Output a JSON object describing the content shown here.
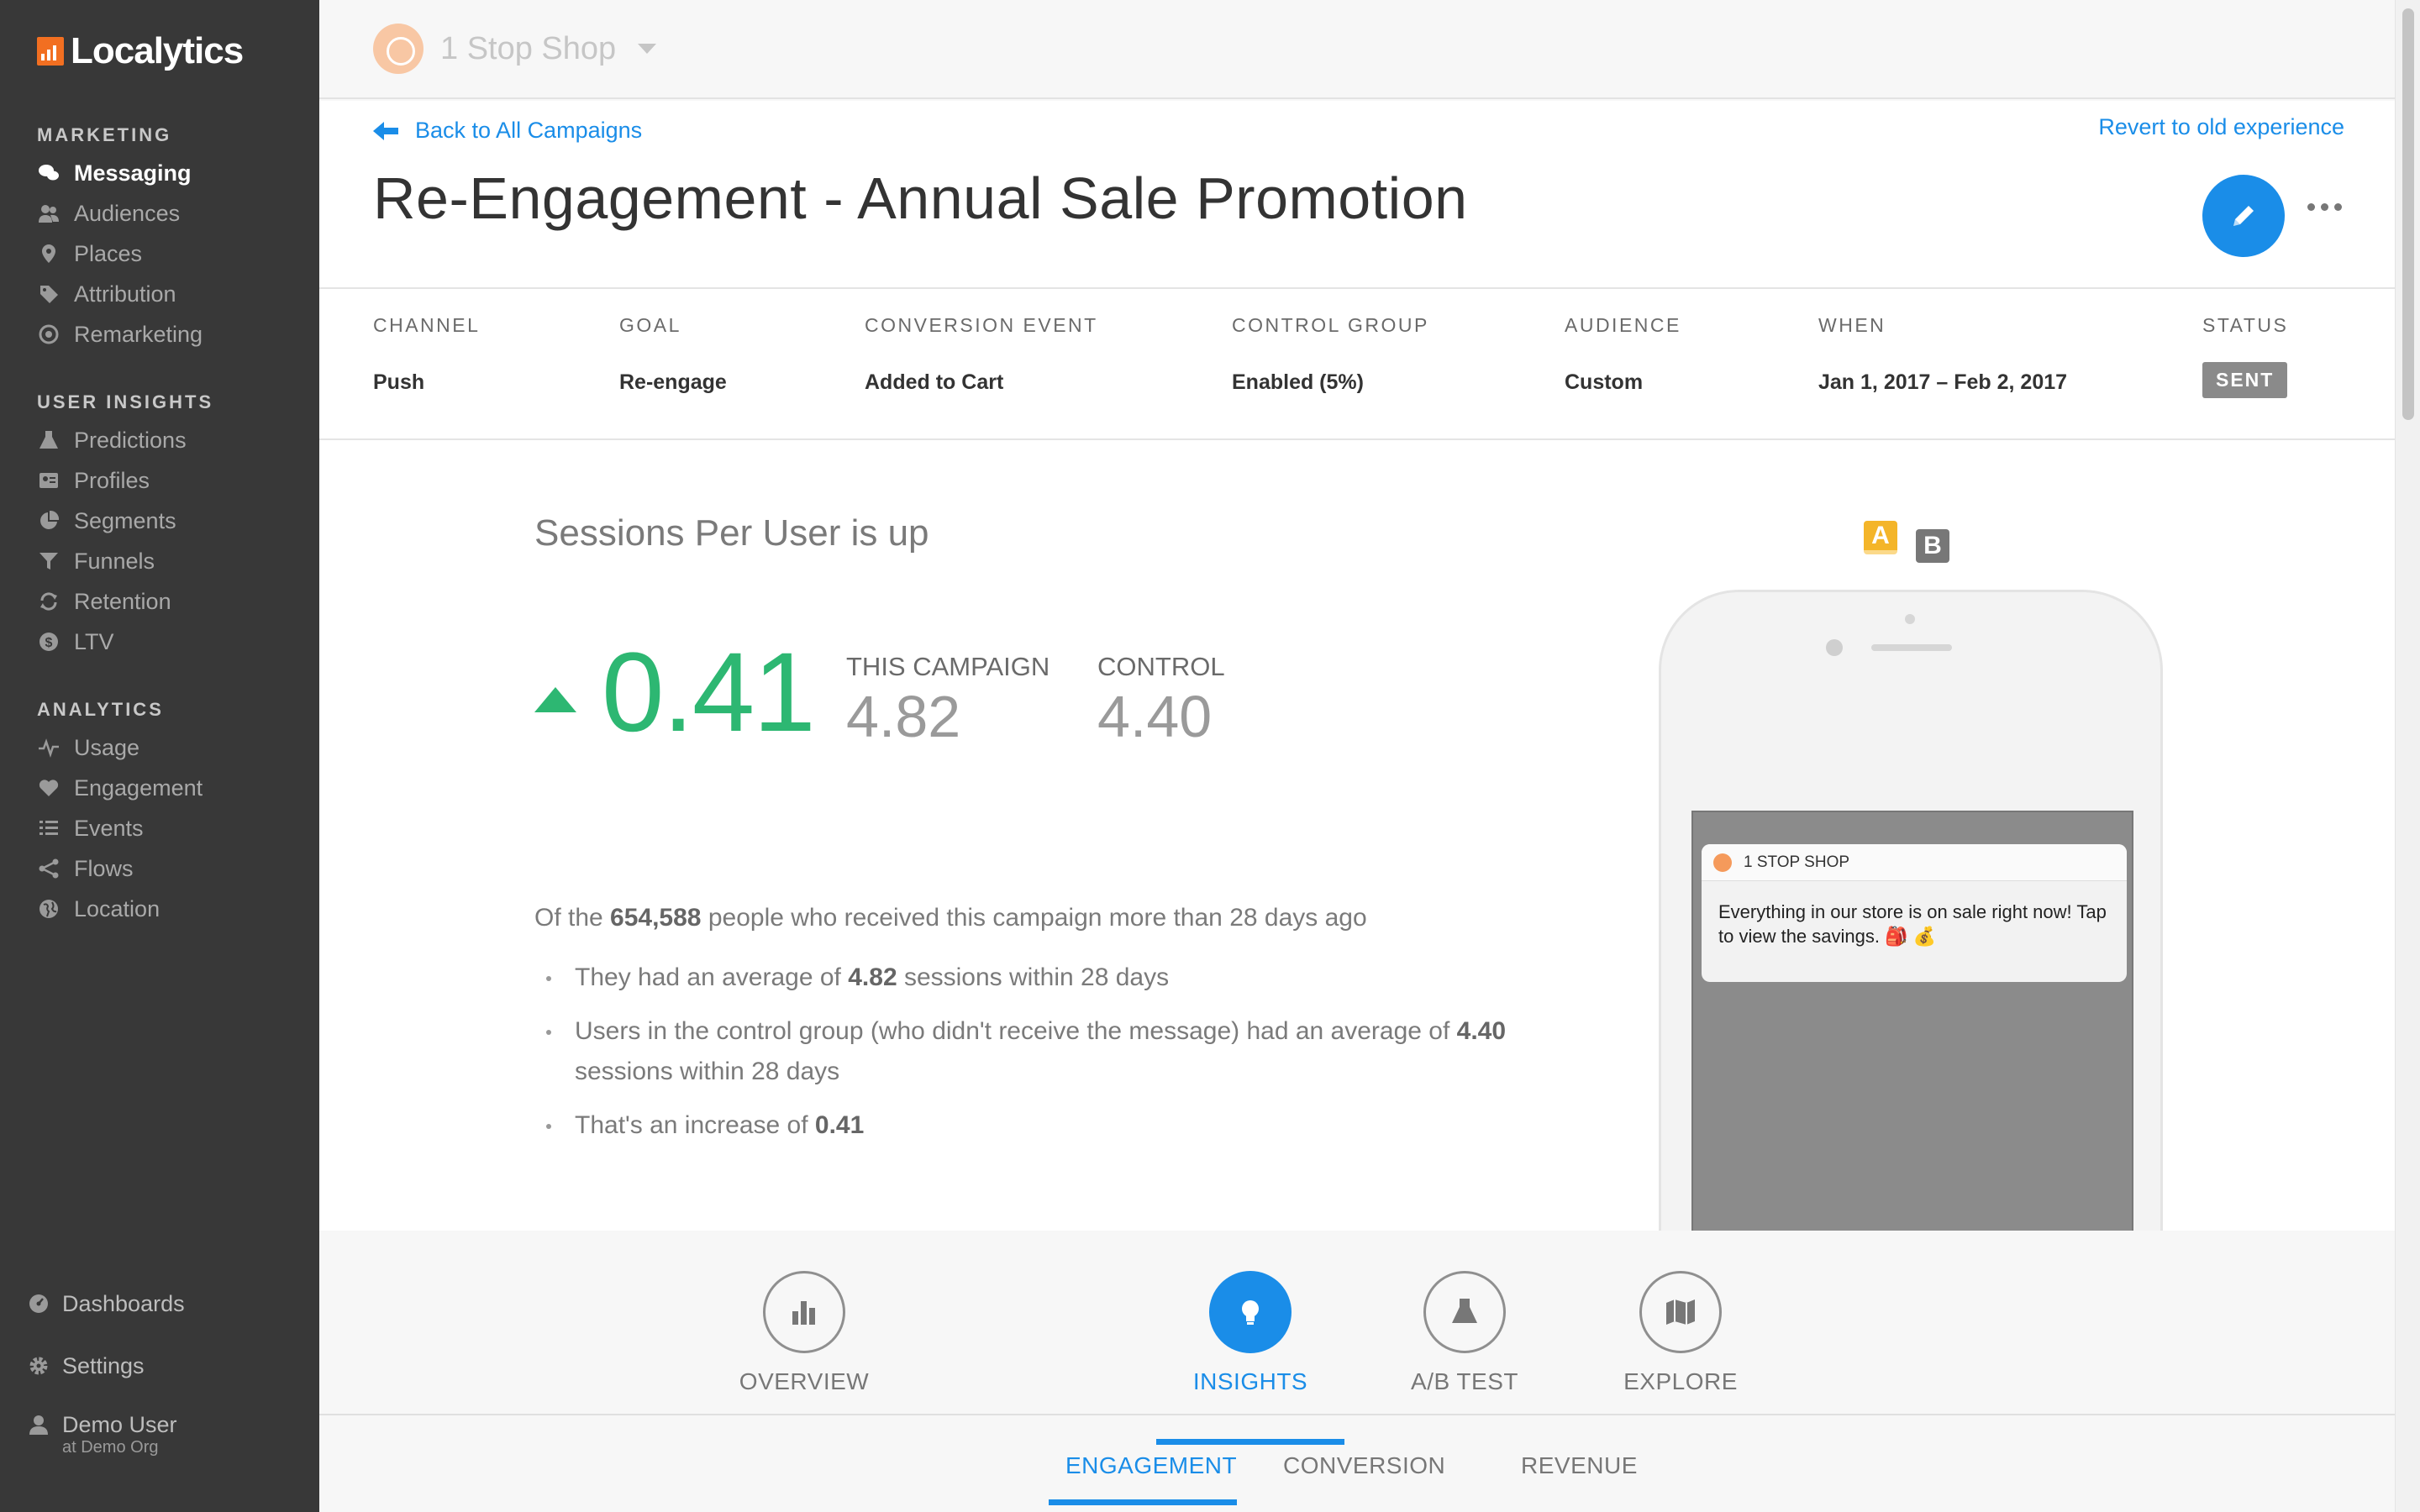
{
  "sidebar": {
    "brand": "Localytics",
    "sections": [
      {
        "heading": "MARKETING",
        "items": [
          {
            "label": "Messaging",
            "icon": "chat-bubbles-icon",
            "active": true
          },
          {
            "label": "Audiences",
            "icon": "people-icon"
          },
          {
            "label": "Places",
            "icon": "map-pin-icon"
          },
          {
            "label": "Attribution",
            "icon": "tag-icon"
          },
          {
            "label": "Remarketing",
            "icon": "target-icon"
          }
        ]
      },
      {
        "heading": "USER INSIGHTS",
        "items": [
          {
            "label": "Predictions",
            "icon": "flask-icon"
          },
          {
            "label": "Profiles",
            "icon": "profile-card-icon"
          },
          {
            "label": "Segments",
            "icon": "pie-icon"
          },
          {
            "label": "Funnels",
            "icon": "funnel-icon"
          },
          {
            "label": "Retention",
            "icon": "refresh-icon"
          },
          {
            "label": "LTV",
            "icon": "dollar-icon"
          }
        ]
      },
      {
        "heading": "ANALYTICS",
        "items": [
          {
            "label": "Usage",
            "icon": "pulse-icon"
          },
          {
            "label": "Engagement",
            "icon": "heart-icon"
          },
          {
            "label": "Events",
            "icon": "list-icon"
          },
          {
            "label": "Flows",
            "icon": "share-icon"
          },
          {
            "label": "Location",
            "icon": "globe-icon"
          }
        ]
      }
    ],
    "bottom": [
      {
        "label": "Dashboards",
        "icon": "dashboard-icon"
      },
      {
        "label": "Settings",
        "icon": "gear-icon"
      }
    ],
    "user": {
      "name": "Demo User",
      "org": "at Demo Org"
    }
  },
  "header": {
    "app_name": "1 Stop Shop"
  },
  "campaign": {
    "back_label": "Back to All Campaigns",
    "revert_label": "Revert to old experience",
    "title": "Re-Engagement - Annual Sale Promotion",
    "meta": [
      {
        "label": "CHANNEL",
        "value": "Push"
      },
      {
        "label": "GOAL",
        "value": "Re-engage"
      },
      {
        "label": "CONVERSION EVENT",
        "value": "Added to Cart"
      },
      {
        "label": "CONTROL GROUP",
        "value": "Enabled (5%)"
      },
      {
        "label": "AUDIENCE",
        "value": "Custom"
      },
      {
        "label": "WHEN",
        "value": "Jan 1, 2017 – Feb 2, 2017"
      },
      {
        "label": "STATUS",
        "value": "SENT"
      }
    ]
  },
  "insight": {
    "heading": "Sessions Per User is up",
    "delta": "0.41",
    "this_campaign_label": "THIS CAMPAIGN",
    "this_campaign_value": "4.82",
    "control_label": "CONTROL",
    "control_value": "4.40",
    "summary_prefix": "Of the ",
    "summary_count": "654,588",
    "summary_suffix": " people who received this campaign more than 28 days ago",
    "bullets": [
      {
        "pre": "They had an average of ",
        "bold": "4.82",
        "post": " sessions within 28 days"
      },
      {
        "pre": "Users in the control group (who didn't receive the message) had an average of ",
        "bold": "4.40",
        "post": " sessions within 28 days"
      },
      {
        "pre": "That's an increase of ",
        "bold": "0.41",
        "post": ""
      }
    ],
    "colors": {
      "positive": "#2db772",
      "accent": "#1a8de8"
    }
  },
  "preview": {
    "variant_a": "A",
    "variant_b": "B",
    "notif_app": "1 STOP SHOP",
    "notif_text": "Everything in our store is on sale right now! Tap to view the savings. 🎒 💰"
  },
  "tabs": {
    "main": [
      {
        "label": "OVERVIEW",
        "icon": "bar-chart-icon"
      },
      {
        "label": "INSIGHTS",
        "icon": "lightbulb-icon",
        "active": true
      },
      {
        "label": "A/B TEST",
        "icon": "flask-icon"
      },
      {
        "label": "EXPLORE",
        "icon": "map-icon"
      }
    ],
    "sub": [
      {
        "label": "ENGAGEMENT",
        "active": true
      },
      {
        "label": "CONVERSION"
      },
      {
        "label": "REVENUE"
      }
    ]
  }
}
